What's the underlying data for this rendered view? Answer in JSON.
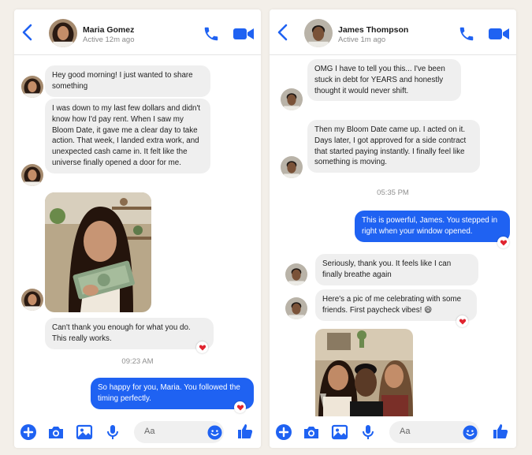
{
  "left_chat": {
    "contact_name": "Maria Gomez",
    "status": "Active 12m ago",
    "messages": [
      "Hey good morning! I just wanted to share something",
      "I was down to my last few dollars and didn't know how I'd pay rent. When I saw my Bloom Date, it gave me a clear day to take action. That week, I landed extra work, and unexpected cash came in. It felt like the universe finally opened a door for me.",
      "Can't thank you enough for what you do. This really works."
    ],
    "timestamp": "09:23 AM",
    "reply": "So happy for you, Maria. You followed the timing perfectly.",
    "input_placeholder": "Aa"
  },
  "right_chat": {
    "contact_name": "James Thompson",
    "status": "Active 1m ago",
    "messages": [
      "OMG I have to tell you this... I've been stuck in debt for YEARS and honestly thought it would never shift.",
      "Then my Bloom Date came up. I acted on it. Days later, I got approved for a side contract that started paying instantly. I finally feel like something is moving."
    ],
    "timestamp": "05:35 PM",
    "reply": "This is powerful, James. You stepped in right when your window opened.",
    "messages_after": [
      "Seriously, thank you. It feels like I can finally breathe again",
      "Here's a pic of me celebrating with some friends. First paycheck vibes! 😄"
    ],
    "input_placeholder": "Aa"
  },
  "colors": {
    "accent": "#1f62f2",
    "heart": "#e0242f",
    "bubble_in": "#efefef"
  }
}
